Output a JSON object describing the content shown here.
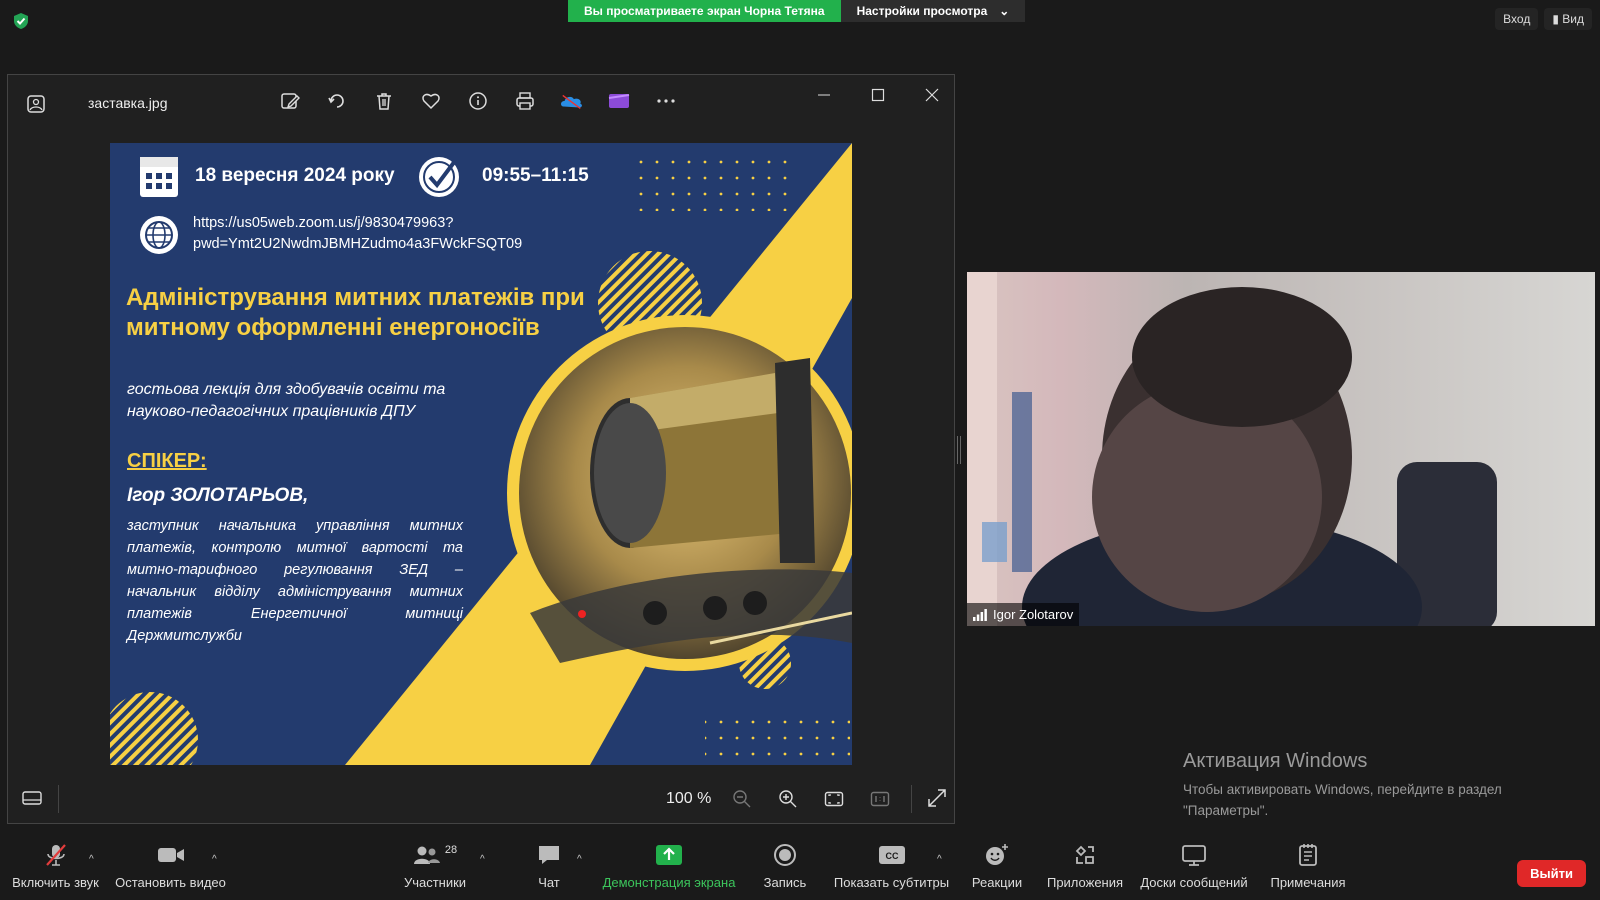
{
  "top": {
    "share_banner_text": "Вы просматриваете экран Чорна Тетяна",
    "view_settings": "Настройки просмотра",
    "login": "Вход",
    "view": "Вид"
  },
  "viewer": {
    "filename": "заставка.jpg",
    "zoom": "100 %",
    "tool_icons": [
      "edit-icon",
      "rotate-icon",
      "delete-icon",
      "favorite-icon",
      "info-icon",
      "print-icon",
      "onedrive-icon",
      "clipchamp-icon",
      "more-icon"
    ]
  },
  "poster": {
    "date": "18 вересня 2024 року",
    "time": "09:55–11:15",
    "link_line1": "https://us05web.zoom.us/j/9830479963?",
    "link_line2": "pwd=Ymt2U2NwdmJBMHZudmo4a3FWckFSQT09",
    "title": "Адміністрування митних платежів при митному оформленні енергоносіїв",
    "subtitle": "гостьова лекція для здобувачів освіти та науково-педагогічних працівників ДПУ",
    "speaker_label": "СПІКЕР:",
    "speaker_name": "Ігор ЗОЛОТАРЬОВ,",
    "speaker_desc": "заступник начальника управління митних платежів, контролю митної вартості та митно-тарифного регулювання ЗЕД – начальник відділу адміністрування митних платежів Енергетичної митниці Держмитслужби",
    "colors": {
      "navy": "#233b6e",
      "yellow": "#f7d044"
    }
  },
  "video": {
    "participant_name": "Igor Zolotarov"
  },
  "activation": {
    "heading": "Активация Windows",
    "text": "Чтобы активировать Windows, перейдите в раздел \"Параметры\"."
  },
  "toolbar": {
    "unmute": "Включить звук",
    "stop_video": "Остановить видео",
    "participants": "Участники",
    "participants_count": "28",
    "chat": "Чат",
    "share_screen": "Демонстрация экрана",
    "record": "Запись",
    "captions": "Показать субтитры",
    "reactions": "Реакции",
    "apps": "Приложения",
    "whiteboards": "Доски сообщений",
    "notes": "Примечания",
    "leave": "Выйти"
  }
}
